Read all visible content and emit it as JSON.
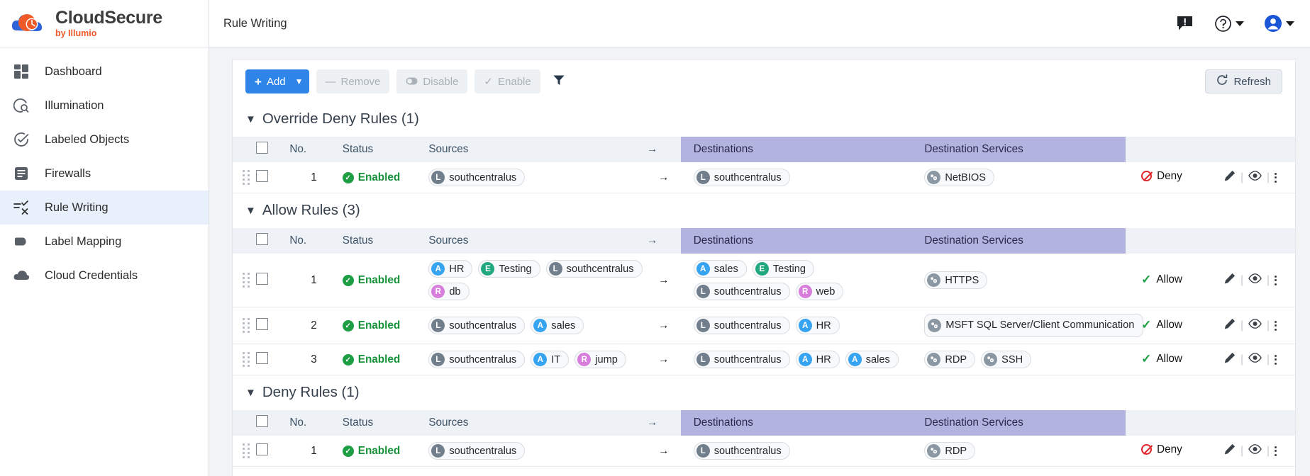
{
  "brand": {
    "title": "CloudSecure",
    "subtitle": "by Illumio",
    "logo_icon": "cloud-clock-logo"
  },
  "sidebar": {
    "items": [
      {
        "label": "Dashboard",
        "icon": "dashboard-icon",
        "active": false
      },
      {
        "label": "Illumination",
        "icon": "illumination-icon",
        "active": false
      },
      {
        "label": "Labeled Objects",
        "icon": "check-circle-icon",
        "active": false
      },
      {
        "label": "Firewalls",
        "icon": "firewall-list-icon",
        "active": false
      },
      {
        "label": "Rule Writing",
        "icon": "rule-writing-icon",
        "active": true
      },
      {
        "label": "Label Mapping",
        "icon": "tag-icon",
        "active": false
      },
      {
        "label": "Cloud Credentials",
        "icon": "cloud-icon",
        "active": false
      }
    ]
  },
  "topbar": {
    "breadcrumb": "Rule Writing",
    "notification_icon": "notification-alert-icon",
    "help_icon": "help-question-icon",
    "account_icon": "user-account-icon"
  },
  "toolbar": {
    "add_label": "Add",
    "add_icon": "plus-icon",
    "add_caret": "⌄",
    "remove_label": "Remove",
    "remove_icon": "minus-icon",
    "disable_label": "Disable",
    "disable_icon": "toggle-off-icon",
    "enable_label": "Enable",
    "enable_icon": "check-icon",
    "filter_icon": "filter-funnel-icon",
    "refresh_label": "Refresh",
    "refresh_icon": "refresh-icon"
  },
  "columns": {
    "no": "No.",
    "status": "Status",
    "sources": "Sources",
    "arrow": "→",
    "destinations": "Destinations",
    "destination_services": "Destination Services"
  },
  "sections": [
    {
      "title": "Override Deny Rules (1)",
      "rows": [
        {
          "no": "1",
          "status": "Enabled",
          "sources": [
            {
              "badge": "L",
              "type": "L",
              "label": "southcentralus"
            }
          ],
          "destinations": [
            {
              "badge": "L",
              "type": "L",
              "label": "southcentralus"
            }
          ],
          "services": [
            {
              "label": "NetBIOS"
            }
          ],
          "action": "Deny"
        }
      ]
    },
    {
      "title": "Allow Rules (3)",
      "rows": [
        {
          "no": "1",
          "status": "Enabled",
          "sources": [
            {
              "badge": "A",
              "type": "A",
              "label": "HR"
            },
            {
              "badge": "E",
              "type": "E",
              "label": "Testing"
            },
            {
              "badge": "L",
              "type": "L",
              "label": "southcentralus"
            },
            {
              "badge": "R",
              "type": "R",
              "label": "db"
            }
          ],
          "destinations": [
            {
              "badge": "A",
              "type": "A",
              "label": "sales"
            },
            {
              "badge": "E",
              "type": "E",
              "label": "Testing"
            },
            {
              "badge": "L",
              "type": "L",
              "label": "southcentralus"
            },
            {
              "badge": "R",
              "type": "R",
              "label": "web"
            }
          ],
          "services": [
            {
              "label": "HTTPS"
            }
          ],
          "action": "Allow"
        },
        {
          "no": "2",
          "status": "Enabled",
          "sources": [
            {
              "badge": "L",
              "type": "L",
              "label": "southcentralus"
            },
            {
              "badge": "A",
              "type": "A",
              "label": "sales"
            }
          ],
          "destinations": [
            {
              "badge": "L",
              "type": "L",
              "label": "southcentralus"
            },
            {
              "badge": "A",
              "type": "A",
              "label": "HR"
            }
          ],
          "services": [
            {
              "label": "MSFT SQL Server/Client Communication",
              "multiline": true
            }
          ],
          "action": "Allow"
        },
        {
          "no": "3",
          "status": "Enabled",
          "sources": [
            {
              "badge": "L",
              "type": "L",
              "label": "southcentralus"
            },
            {
              "badge": "A",
              "type": "A",
              "label": "IT"
            },
            {
              "badge": "R",
              "type": "R",
              "label": "jump"
            }
          ],
          "destinations": [
            {
              "badge": "L",
              "type": "L",
              "label": "southcentralus"
            },
            {
              "badge": "A",
              "type": "A",
              "label": "HR"
            },
            {
              "badge": "A",
              "type": "A",
              "label": "sales"
            }
          ],
          "services": [
            {
              "label": "RDP"
            },
            {
              "label": "SSH"
            }
          ],
          "action": "Allow"
        }
      ]
    },
    {
      "title": "Deny Rules (1)",
      "rows": [
        {
          "no": "1",
          "status": "Enabled",
          "sources": [
            {
              "badge": "L",
              "type": "L",
              "label": "southcentralus"
            }
          ],
          "destinations": [
            {
              "badge": "L",
              "type": "L",
              "label": "southcentralus"
            }
          ],
          "services": [
            {
              "label": "RDP"
            }
          ],
          "action": "Deny"
        }
      ]
    }
  ],
  "row_tools": {
    "edit_icon": "pencil-edit-icon",
    "view_icon": "eye-view-icon",
    "more_icon": "kebab-menu-icon"
  },
  "colors": {
    "accent_blue": "#2f86e8",
    "brand_orange": "#f05a28",
    "dest_header_purple": "#b3b3e0",
    "allow_green": "#1d9e43",
    "deny_red": "#e0252b",
    "sidebar_active": "#e8f0fb"
  }
}
